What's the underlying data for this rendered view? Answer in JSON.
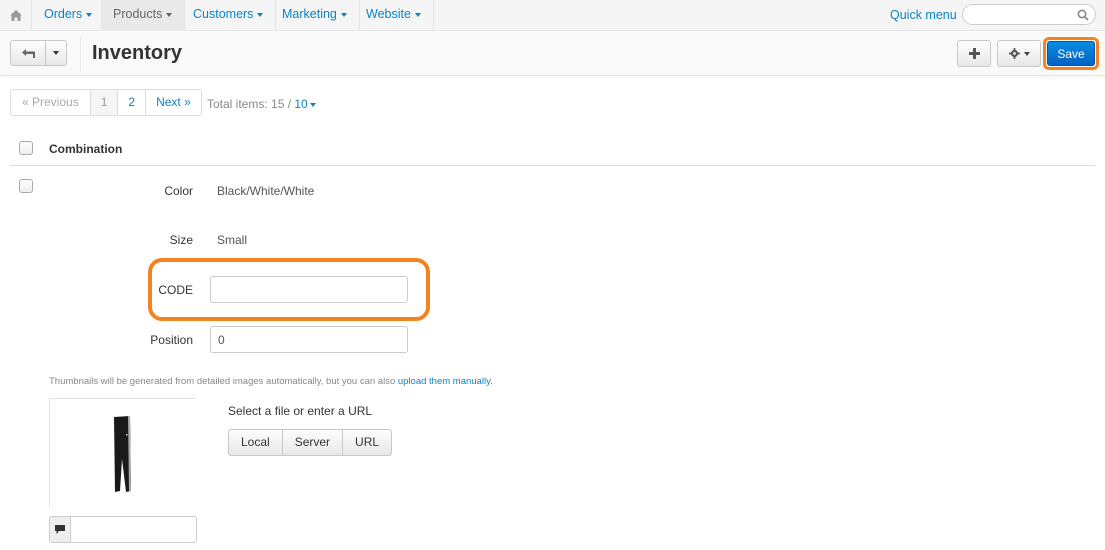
{
  "topnav": {
    "home_icon": "home-icon",
    "items": [
      {
        "label": "Orders",
        "active": false
      },
      {
        "label": "Products",
        "active": true
      },
      {
        "label": "Customers",
        "active": false
      },
      {
        "label": "Marketing",
        "active": false
      },
      {
        "label": "Website",
        "active": false
      }
    ],
    "quick_menu": "Quick menu",
    "search": {
      "value": "",
      "placeholder": "",
      "icon": "search-icon"
    }
  },
  "toolbar": {
    "title": "Inventory",
    "back_icon": "back-arrow-icon",
    "add_icon": "plus-icon",
    "settings_icon": "gear-icon",
    "save_label": "Save"
  },
  "pagination": {
    "previous": "« Previous",
    "pages": [
      "1",
      "2"
    ],
    "current_page": "1",
    "next": "Next »",
    "total_label": "Total items: 15 / ",
    "per_page": "10"
  },
  "table": {
    "column_header": "Combination",
    "row": {
      "fields": [
        {
          "label": "Color",
          "value": "Black/White/White"
        },
        {
          "label": "Size",
          "value": "Small"
        }
      ],
      "code": {
        "label": "CODE",
        "value": ""
      },
      "position": {
        "label": "Position",
        "value": "0"
      }
    }
  },
  "images": {
    "hint_text": "Thumbnails will be generated from detailed images automatically, but you can also ",
    "hint_link": "upload them manually.",
    "select_label": "Select a file or enter a URL",
    "upload_buttons": [
      "Local",
      "Server",
      "URL"
    ],
    "alt_input": {
      "value": "",
      "icon": "comment-icon"
    }
  },
  "colors": {
    "accent": "#0b83c5",
    "highlight": "#f58220",
    "save": "#0460c5"
  }
}
